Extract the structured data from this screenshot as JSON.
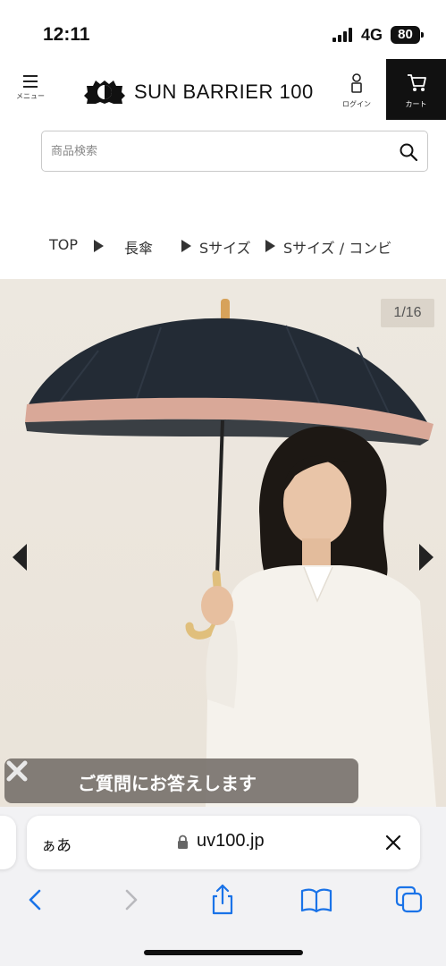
{
  "status_bar": {
    "time": "12:11",
    "network": "4G",
    "battery": "80"
  },
  "header": {
    "menu_label": "メニュー",
    "logo_text": "SUN BARRIER 100",
    "login_label": "ログイン",
    "cart_label": "カート"
  },
  "search": {
    "placeholder": "商品検索",
    "value": ""
  },
  "breadcrumb": {
    "items": [
      "TOP",
      "長傘",
      "Sサイズ",
      "Sサイズ / コンビ"
    ]
  },
  "gallery": {
    "counter": "1/16"
  },
  "faq_banner": {
    "text": "ご質問にお答えします"
  },
  "safari": {
    "aa_label": "ぁあ",
    "url": "uv100.jp"
  },
  "colors": {
    "accent_dark": "#111111",
    "canopy": "#232b35",
    "trim": "#d9a898",
    "banner": "#78736e",
    "ios_blue": "#1a73e8"
  }
}
